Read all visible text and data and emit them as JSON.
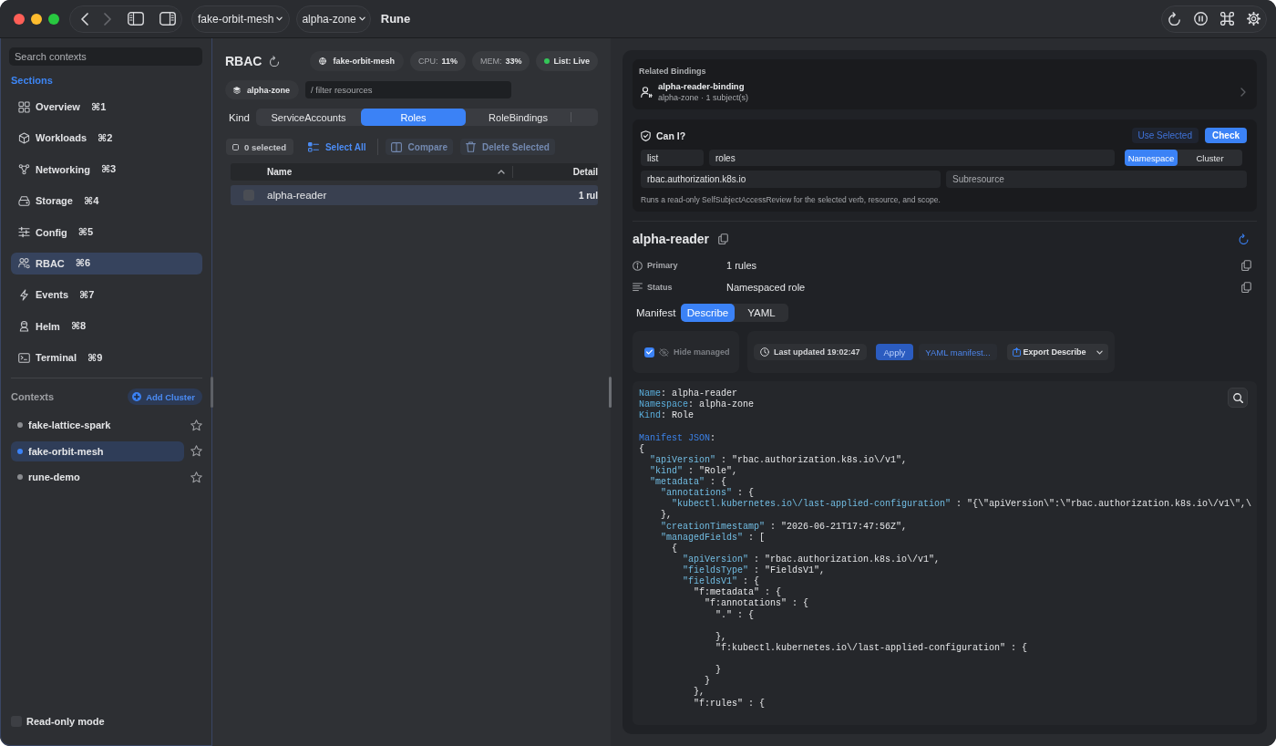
{
  "window": {
    "title": "Rune",
    "context_menu": "fake-orbit-mesh",
    "namespace_menu": "alpha-zone"
  },
  "sidebar": {
    "search": {
      "placeholder": "Search contexts"
    },
    "sections_label": "Sections",
    "sections": [
      {
        "label": "Overview",
        "shortcut": "⌘1",
        "selected": false
      },
      {
        "label": "Workloads",
        "shortcut": "⌘2",
        "selected": false
      },
      {
        "label": "Networking",
        "shortcut": "⌘3",
        "selected": false
      },
      {
        "label": "Storage",
        "shortcut": "⌘4",
        "selected": false
      },
      {
        "label": "Config",
        "shortcut": "⌘5",
        "selected": false
      },
      {
        "label": "RBAC",
        "shortcut": "⌘6",
        "selected": true
      },
      {
        "label": "Events",
        "shortcut": "⌘7",
        "selected": false
      },
      {
        "label": "Helm",
        "shortcut": "⌘8",
        "selected": false
      },
      {
        "label": "Terminal",
        "shortcut": "⌘9",
        "selected": false
      }
    ],
    "contexts_label": "Contexts",
    "add_cluster": "Add Cluster",
    "contexts": [
      {
        "name": "fake-lattice-spark",
        "selected": false,
        "starred": false
      },
      {
        "name": "fake-orbit-mesh",
        "selected": true,
        "starred": false
      },
      {
        "name": "rune-demo",
        "selected": false,
        "starred": false
      }
    ],
    "read_only": {
      "label": "Read-only mode",
      "checked": false
    }
  },
  "resources": {
    "title": "RBAC",
    "context_chip": "fake-orbit-mesh",
    "metrics": [
      {
        "label": "CPU:",
        "value": "11%"
      },
      {
        "label": "MEM:",
        "value": "33%"
      }
    ],
    "live": "List: Live",
    "namespace_chip": "alpha-zone",
    "filter": {
      "placeholder": "/ filter resources"
    },
    "kind_label": "Kind",
    "kinds": [
      {
        "label": "ServiceAccounts",
        "selected": false
      },
      {
        "label": "Roles",
        "selected": true
      },
      {
        "label": "RoleBindings",
        "selected": false
      }
    ],
    "selection_count": "0 selected",
    "actions": [
      {
        "label": "Select All",
        "disabled": false
      },
      {
        "label": "Compare",
        "disabled": true
      },
      {
        "label": "Delete Selected",
        "disabled": true
      }
    ],
    "table": {
      "columns": [
        {
          "label": "Name",
          "sorted": true
        },
        {
          "label": "Detail"
        }
      ],
      "rows": [
        {
          "name": "alpha-reader",
          "detail": "1 rul",
          "checked": false,
          "selected": true
        }
      ]
    }
  },
  "inspector": {
    "related_bindings": {
      "title": "Related Bindings",
      "items": [
        {
          "name": "alpha-reader-binding",
          "meta": "alpha-zone · 1 subject(s)"
        }
      ]
    },
    "can_i": {
      "title": "Can I?",
      "use_selected": "Use Selected",
      "check": "Check",
      "verb": {
        "value": "list"
      },
      "resource": {
        "value": "roles"
      },
      "scopes": [
        {
          "label": "Namespace",
          "selected": true
        },
        {
          "label": "Cluster",
          "selected": false
        }
      ],
      "api_group": {
        "value": "rbac.authorization.k8s.io"
      },
      "subresource": {
        "placeholder": "Subresource"
      },
      "hint": "Runs a read-only SelfSubjectAccessReview for the selected verb, resource, and scope."
    },
    "title": "alpha-reader",
    "fields": [
      {
        "label": "Primary",
        "value": "1 rules"
      },
      {
        "label": "Status",
        "value": "Namespaced role"
      }
    ],
    "manifest_label": "Manifest",
    "modes": [
      {
        "label": "Describe",
        "selected": true
      },
      {
        "label": "YAML",
        "selected": false
      }
    ],
    "hide_managed": {
      "label": "Hide managed",
      "checked": true,
      "disabled": true
    },
    "last_updated": "Last updated 19:02:47",
    "apply": "Apply",
    "yaml_link": "YAML manifest...",
    "export": "Export Describe",
    "code": [
      {
        "lines": [
          {
            "parts": [
              {
                "kind": "field",
                "text": "Name"
              },
              {
                "kind": "plain",
                "text": ": alpha-reader"
              }
            ]
          },
          {
            "parts": [
              {
                "kind": "field",
                "text": "Namespace"
              },
              {
                "kind": "plain",
                "text": ": alpha-zone"
              }
            ]
          },
          {
            "parts": [
              {
                "kind": "field",
                "text": "Kind"
              },
              {
                "kind": "plain",
                "text": ": Role"
              }
            ]
          }
        ]
      },
      {
        "lines": [
          {
            "parts": [
              {
                "kind": "heading",
                "text": "Manifest JSON"
              },
              {
                "kind": "plain",
                "text": ":"
              }
            ]
          },
          {
            "parts": [
              {
                "kind": "plain",
                "text": "{"
              }
            ]
          },
          {
            "parts": [
              {
                "kind": "key",
                "text": "  \"apiVersion\""
              },
              {
                "kind": "plain",
                "text": " : \"rbac.authorization.k8s.io\\/v1\","
              }
            ]
          },
          {
            "parts": [
              {
                "kind": "key",
                "text": "  \"kind\""
              },
              {
                "kind": "plain",
                "text": " : \"Role\","
              }
            ]
          },
          {
            "parts": [
              {
                "kind": "key",
                "text": "  \"metadata\""
              },
              {
                "kind": "plain",
                "text": " : {"
              }
            ]
          },
          {
            "parts": [
              {
                "kind": "key",
                "text": "    \"annotations\""
              },
              {
                "kind": "plain",
                "text": " : {"
              }
            ]
          },
          {
            "parts": [
              {
                "kind": "key",
                "text": "      \"kubectl.kubernetes.io\\/last-applied-configuration\""
              },
              {
                "kind": "plain",
                "text": " : \"{\\\"apiVersion\\\":\\\"rbac.authorization.k8s.io\\/v1\\\",\\"
              }
            ]
          },
          {
            "parts": [
              {
                "kind": "plain",
                "text": "    },"
              }
            ]
          },
          {
            "parts": [
              {
                "kind": "key",
                "text": "    \"creationTimestamp\""
              },
              {
                "kind": "plain",
                "text": " : \"2026-06-21T17:47:56Z\","
              }
            ]
          },
          {
            "parts": [
              {
                "kind": "key",
                "text": "    \"managedFields\""
              },
              {
                "kind": "plain",
                "text": " : ["
              }
            ]
          },
          {
            "parts": [
              {
                "kind": "plain",
                "text": "      {"
              }
            ]
          },
          {
            "parts": [
              {
                "kind": "key",
                "text": "        \"apiVersion\""
              },
              {
                "kind": "plain",
                "text": " : \"rbac.authorization.k8s.io\\/v1\","
              }
            ]
          },
          {
            "parts": [
              {
                "kind": "key",
                "text": "        \"fieldsType\""
              },
              {
                "kind": "plain",
                "text": " : \"FieldsV1\","
              }
            ]
          },
          {
            "parts": [
              {
                "kind": "key",
                "text": "        \"fieldsV1\""
              },
              {
                "kind": "plain",
                "text": " : {"
              }
            ]
          },
          {
            "parts": [
              {
                "kind": "plain",
                "text": "          \"f:metadata\" : {"
              }
            ]
          },
          {
            "parts": [
              {
                "kind": "plain",
                "text": "            \"f:annotations\" : {"
              }
            ]
          },
          {
            "parts": [
              {
                "kind": "plain",
                "text": "              \".\" : {"
              }
            ]
          }
        ]
      },
      {
        "lines": [
          {
            "parts": [
              {
                "kind": "plain",
                "text": "              },"
              }
            ]
          },
          {
            "parts": [
              {
                "kind": "plain",
                "text": "              \"f:kubectl.kubernetes.io\\/last-applied-configuration\" : {"
              }
            ]
          }
        ]
      },
      {
        "lines": [
          {
            "parts": [
              {
                "kind": "plain",
                "text": "              }"
              }
            ]
          },
          {
            "parts": [
              {
                "kind": "plain",
                "text": "            }"
              }
            ]
          },
          {
            "parts": [
              {
                "kind": "plain",
                "text": "          },"
              }
            ]
          },
          {
            "parts": [
              {
                "kind": "plain",
                "text": "          \"f:rules\" : {"
              }
            ]
          }
        ]
      }
    ]
  }
}
